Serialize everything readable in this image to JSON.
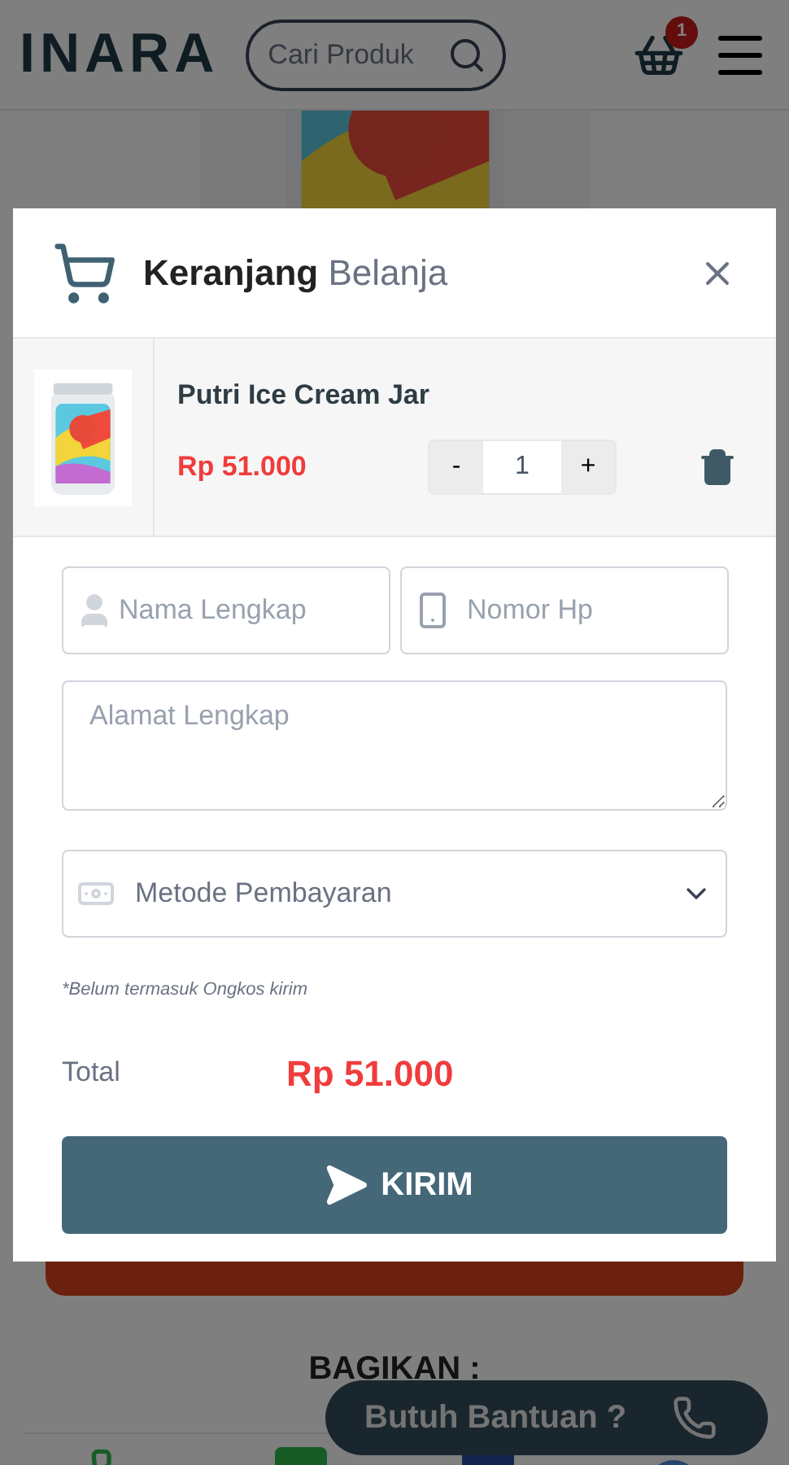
{
  "header": {
    "logo": "INARA",
    "search": {
      "placeholder": "Cari Produk"
    },
    "cart_count": "1"
  },
  "share": {
    "title": "BAGIKAN :"
  },
  "help_button": {
    "label": "Butuh Bantuan ?"
  },
  "cart_modal": {
    "title_bold": "Keranjang",
    "title_light": "Belanja",
    "items": [
      {
        "name": "Putri Ice Cream Jar",
        "price": "Rp 51.000",
        "quantity": "1",
        "decrement": "-",
        "increment": "+"
      }
    ],
    "form": {
      "name": {
        "placeholder": "Nama Lengkap"
      },
      "phone": {
        "placeholder": "Nomor Hp"
      },
      "address": {
        "placeholder": "Alamat Lengkap"
      },
      "payment": {
        "placeholder": "Metode Pembayaran"
      }
    },
    "note": "*Belum termasuk Ongkos kirim",
    "total_label": "Total",
    "total_value": "Rp 51.000",
    "submit": "KIRIM"
  }
}
